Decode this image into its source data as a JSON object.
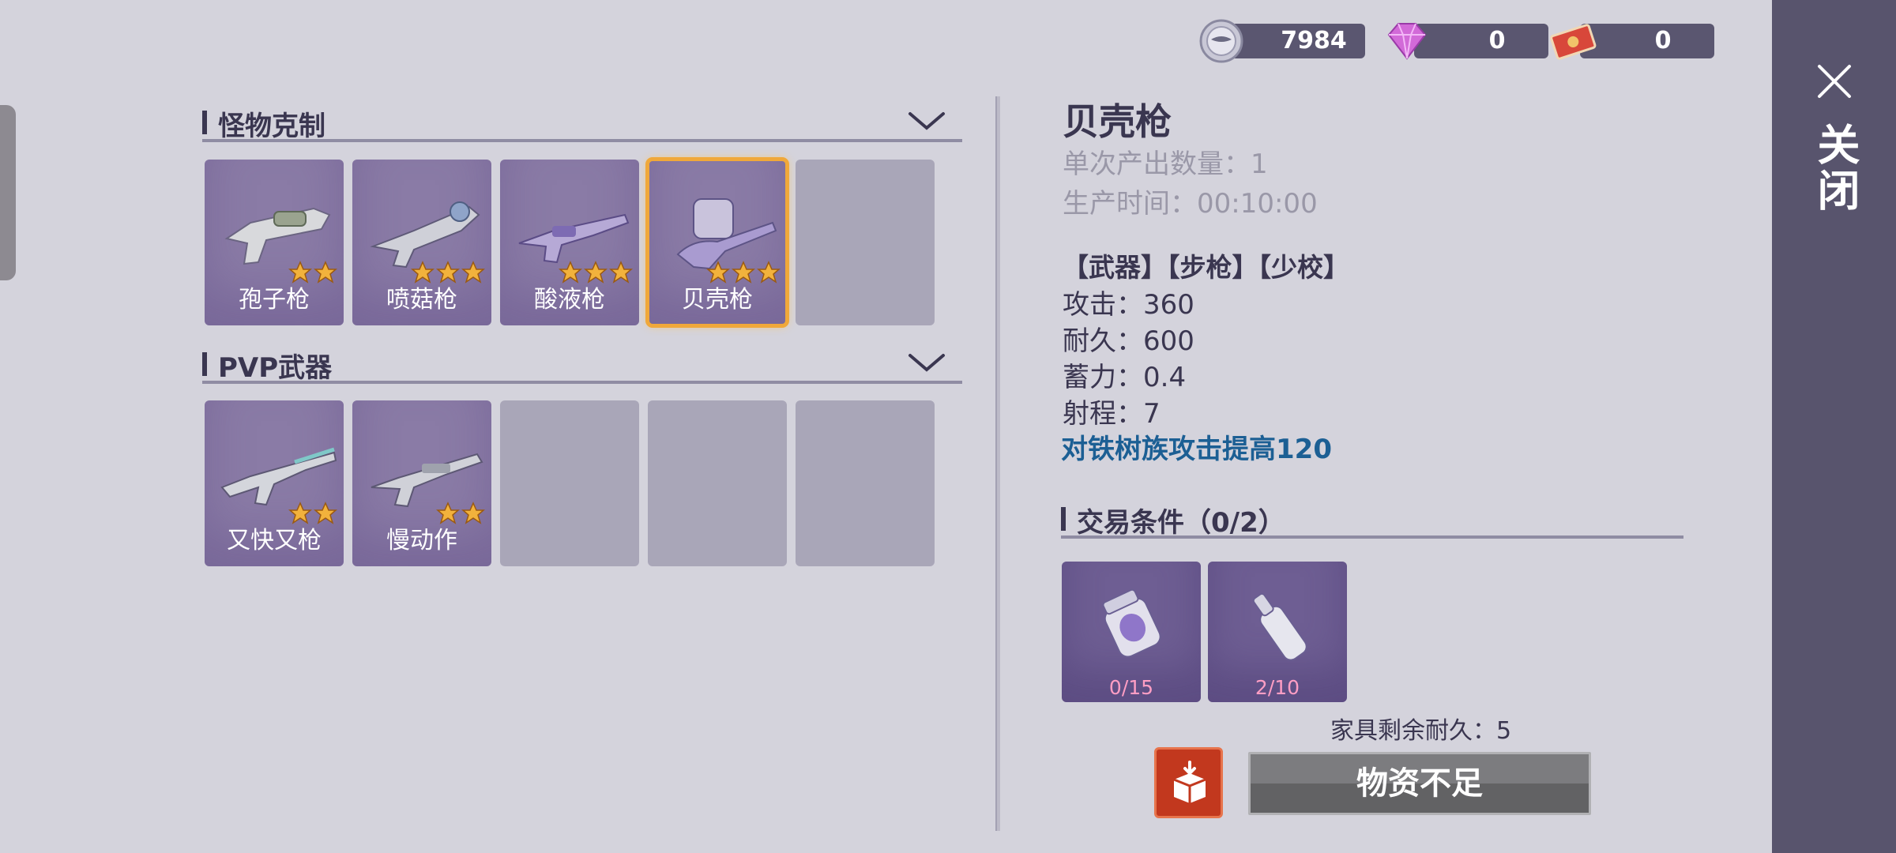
{
  "currency": [
    {
      "icon": "silver-coin-icon",
      "value": "7984"
    },
    {
      "icon": "diamond-gem-icon",
      "value": "0"
    },
    {
      "icon": "red-ticket-icon",
      "value": "0"
    }
  ],
  "close_label": "关闭",
  "sections": [
    {
      "title": "怪物克制",
      "items": [
        {
          "name": "孢子枪",
          "stars": 2
        },
        {
          "name": "喷菇枪",
          "stars": 3
        },
        {
          "name": "酸液枪",
          "stars": 3
        },
        {
          "name": "贝壳枪",
          "stars": 3,
          "selected": true
        }
      ]
    },
    {
      "title": "PVP武器",
      "items": [
        {
          "name": "又快又枪",
          "stars": 2
        },
        {
          "name": "慢动作",
          "stars": 2
        }
      ]
    }
  ],
  "detail": {
    "title": "贝壳枪",
    "output": "单次产出数量：1",
    "time": "生产时间：00:10:00",
    "tags": "【武器】【步枪】【少校】",
    "stats": [
      "攻击：360",
      "耐久：600",
      "蓄力：0.4",
      "射程：7"
    ],
    "bonus": "对铁树族攻击提高120"
  },
  "trade": {
    "title": "交易条件（0/2）",
    "materials": [
      {
        "icon": "jar-icon",
        "count": "0/15"
      },
      {
        "icon": "bottle-icon",
        "count": "2/10"
      }
    ]
  },
  "durability": "家具剩余耐久：5",
  "action_button": "物资不足",
  "colors": {
    "accent_gold": "#f0a83a",
    "bonus_text": "#1c5f94",
    "count_pink": "#ff9ec4",
    "box_red": "#c2381e"
  }
}
